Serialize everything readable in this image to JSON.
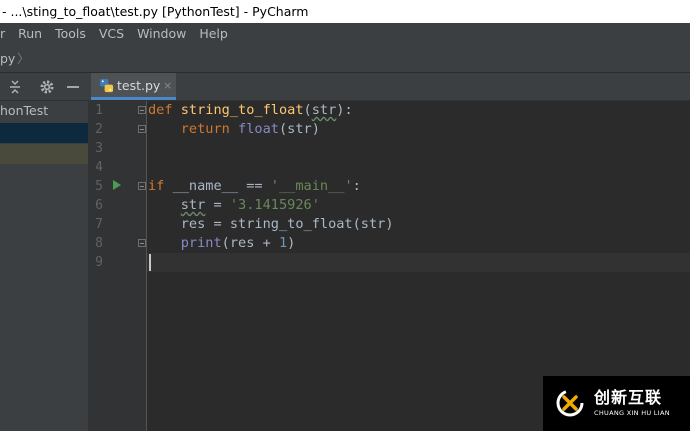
{
  "window": {
    "title": "- ...\\sting_to_float\\test.py [PythonTest] - PyCharm"
  },
  "menu": [
    "r",
    "Run",
    "Tools",
    "VCS",
    "Window",
    "Help"
  ],
  "nav": {
    "crumb": "py",
    "separator": "〉"
  },
  "project": {
    "label": "honTest"
  },
  "tab": {
    "label": "test.py",
    "close": "×"
  },
  "editor": {
    "line_numbers": [
      "1",
      "2",
      "3",
      "4",
      "5",
      "6",
      "7",
      "8",
      "9"
    ],
    "code": {
      "l1_def": "def ",
      "l1_fn": "string_to_float",
      "l1_open": "(",
      "l1_param": "str",
      "l1_close": "):",
      "l2_return": "return ",
      "l2_fn": "float",
      "l2_args": "(str)",
      "l5_if": "if ",
      "l5_name": "__name__",
      "l5_op": " == ",
      "l5_str": "'__main__'",
      "l5_colon": ":",
      "l6_var": "str",
      "l6_eq": " = ",
      "l6_str": "'3.1415926'",
      "l7_text": "res = string_to_float(str)",
      "l8_print": "print",
      "l8_mid": "(res + ",
      "l8_num": "1",
      "l8_close": ")"
    }
  },
  "watermark": {
    "cn": "创新互联",
    "en": "CHUANG XIN HU LIAN"
  },
  "colors": {
    "keyword": "#cc7832",
    "function": "#ffc66d",
    "string": "#6a8759",
    "number": "#6897bb",
    "builtin": "#8888c6",
    "magic": "#b200b2",
    "accent": "#4a88c7"
  }
}
